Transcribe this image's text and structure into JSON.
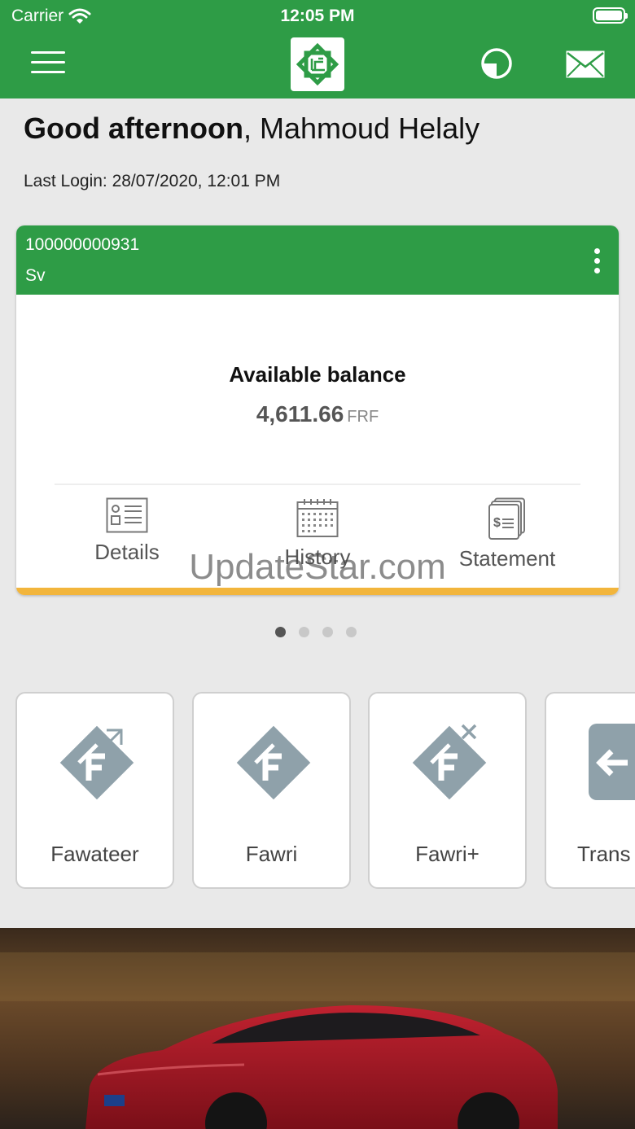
{
  "status_bar": {
    "carrier": "Carrier",
    "time": "12:05 PM"
  },
  "header": {
    "menu_icon": "hamburger-icon",
    "logo_icon": "bank-logo",
    "pie_icon": "pie-chart-icon",
    "mail_icon": "mail-icon"
  },
  "greeting": {
    "salutation": "Good afternoon",
    "separator": ",",
    "name": " Mahmoud Helaly"
  },
  "last_login": "Last Login: 28/07/2020, 12:01 PM",
  "account_card": {
    "account_number": "100000000931",
    "account_type": "Sv",
    "balance_label": "Available balance",
    "balance_value": "4,611.66",
    "currency": "FRF",
    "actions": [
      {
        "label": "Details",
        "icon": "details-icon"
      },
      {
        "label": "History",
        "icon": "calendar-icon"
      },
      {
        "label": "Statement",
        "icon": "statement-icon"
      }
    ],
    "accent_color": "#f2b53c"
  },
  "pager": {
    "count": 4,
    "active": 0
  },
  "watermark": "UpdateStar.com",
  "services": [
    {
      "label": "Fawateer",
      "icon": "fawateer-icon"
    },
    {
      "label": "Fawri",
      "icon": "fawri-icon"
    },
    {
      "label": "Fawri+",
      "icon": "fawri-plus-icon"
    },
    {
      "label": "Trans",
      "icon": "transfer-icon"
    }
  ],
  "colors": {
    "brand_green": "#2e9c46",
    "icon_gray": "#8fa1aa",
    "car_red": "#a2141f"
  }
}
